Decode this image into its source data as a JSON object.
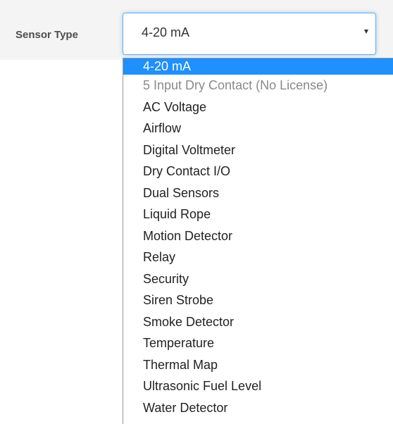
{
  "form": {
    "sensor_type_label": "Sensor Type"
  },
  "select": {
    "value": "4-20 mA"
  },
  "options": [
    {
      "label": "4-20 mA",
      "state": "selected"
    },
    {
      "label": "5 Input Dry Contact (No License)",
      "state": "disabled"
    },
    {
      "label": "AC Voltage",
      "state": "normal"
    },
    {
      "label": "Airflow",
      "state": "normal"
    },
    {
      "label": "Digital Voltmeter",
      "state": "normal"
    },
    {
      "label": "Dry Contact I/O",
      "state": "normal"
    },
    {
      "label": "Dual Sensors",
      "state": "normal"
    },
    {
      "label": "Liquid Rope",
      "state": "normal"
    },
    {
      "label": "Motion Detector",
      "state": "normal"
    },
    {
      "label": "Relay",
      "state": "normal"
    },
    {
      "label": "Security",
      "state": "normal"
    },
    {
      "label": "Siren Strobe",
      "state": "normal"
    },
    {
      "label": "Smoke Detector",
      "state": "normal"
    },
    {
      "label": "Temperature",
      "state": "normal"
    },
    {
      "label": "Thermal Map",
      "state": "normal"
    },
    {
      "label": "Ultrasonic Fuel Level",
      "state": "normal"
    },
    {
      "label": "Water Detector",
      "state": "normal"
    }
  ],
  "colors": {
    "highlight": "#1e90ff",
    "focus_border": "#66afe9",
    "disabled_text": "#8a8a8a"
  }
}
